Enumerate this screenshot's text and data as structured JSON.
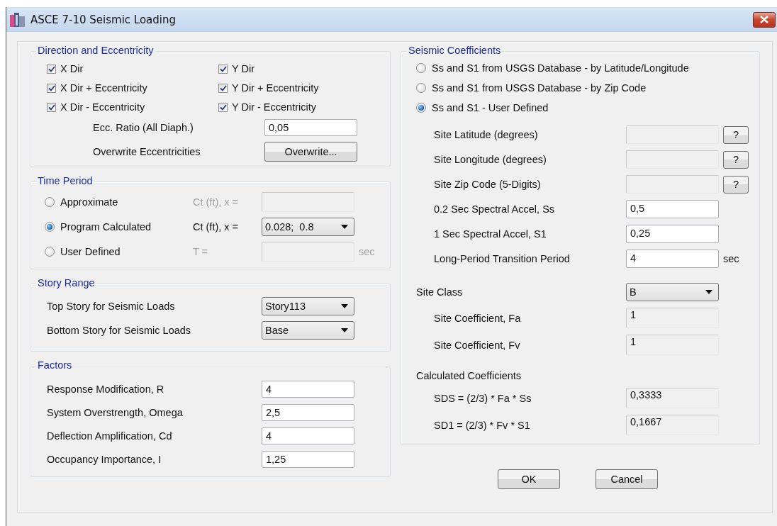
{
  "window": {
    "title": "ASCE 7-10 Seismic Loading"
  },
  "direction_eccentricity": {
    "title": "Direction and Eccentricity",
    "checkboxes": [
      {
        "label": "X Dir",
        "checked": true
      },
      {
        "label": "Y Dir",
        "checked": true
      },
      {
        "label": "X Dir + Eccentricity",
        "checked": true
      },
      {
        "label": "Y Dir + Eccentricity",
        "checked": true
      },
      {
        "label": "X Dir - Eccentricity",
        "checked": true
      },
      {
        "label": "Y Dir - Eccentricity",
        "checked": true
      }
    ],
    "ecc_ratio": {
      "label": "Ecc. Ratio (All Diaph.)",
      "value": "0,05"
    },
    "overwrite": {
      "label": "Overwrite Eccentricities",
      "button": "Overwrite..."
    }
  },
  "time_period": {
    "title": "Time Period",
    "options": [
      {
        "label": "Approximate",
        "selected": false,
        "param_label": "Ct (ft), x =",
        "kind": "text"
      },
      {
        "label": "Program Calculated",
        "selected": true,
        "param_label": "Ct (ft), x =",
        "kind": "dropdown",
        "value": "0.028;  0.8"
      },
      {
        "label": "User Defined",
        "selected": false,
        "param_label": "T =",
        "kind": "text",
        "unit": "sec"
      }
    ]
  },
  "story_range": {
    "title": "Story Range",
    "rows": [
      {
        "label": "Top Story for Seismic Loads",
        "value": "Story113"
      },
      {
        "label": "Bottom Story for Seismic Loads",
        "value": "Base"
      }
    ]
  },
  "factors": {
    "title": "Factors",
    "rows": [
      {
        "label": "Response Modification, R",
        "value": "4"
      },
      {
        "label": "System Overstrength, Omega",
        "value": "2,5"
      },
      {
        "label": "Deflection Amplification, Cd",
        "value": "4"
      },
      {
        "label": "Occupancy Importance, I",
        "value": "1,25"
      }
    ]
  },
  "seismic_coefficients": {
    "title": "Seismic Coefficients",
    "options": [
      {
        "label": "Ss and S1 from USGS Database - by Latitude/Longitude",
        "selected": false
      },
      {
        "label": "Ss and S1 from USGS Database - by Zip Code",
        "selected": false
      },
      {
        "label": "Ss and S1 - User Defined",
        "selected": true
      }
    ],
    "site_rows": [
      {
        "label": "Site Latitude (degrees)",
        "kind": "readonly",
        "help": "?"
      },
      {
        "label": "Site Longitude (degrees)",
        "kind": "readonly",
        "help": "?"
      },
      {
        "label": "Site Zip Code (5-Digits)",
        "kind": "readonly",
        "help": "?"
      },
      {
        "label": "0.2 Sec Spectral Accel, Ss",
        "kind": "input",
        "value": "0,5"
      },
      {
        "label": "1 Sec Spectral Accel, S1",
        "kind": "input",
        "value": "0,25"
      },
      {
        "label": "Long-Period Transition Period",
        "kind": "input",
        "value": "4",
        "unit": "sec"
      }
    ],
    "site_class": {
      "label": "Site Class",
      "value": "B"
    },
    "site_coefficients": [
      {
        "label": "Site Coefficient, Fa",
        "value": "1"
      },
      {
        "label": "Site Coefficient, Fv",
        "value": "1"
      }
    ],
    "calculated": {
      "title": "Calculated Coefficients",
      "rows": [
        {
          "label": "SDS = (2/3) * Fa * Ss",
          "value": "0,3333"
        },
        {
          "label": "SD1 = (2/3) * Fv * S1",
          "value": "0,1667"
        }
      ]
    }
  },
  "buttons": [
    "OK",
    "Cancel"
  ]
}
